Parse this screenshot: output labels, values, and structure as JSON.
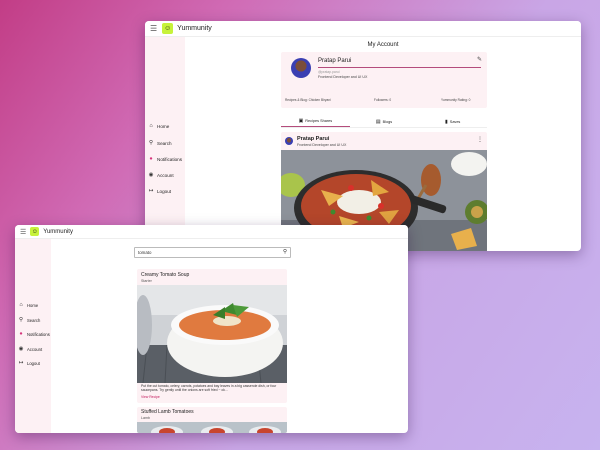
{
  "app": {
    "name": "Yummunity",
    "logo_glyph": "☺",
    "brand_color": "#c7f23a",
    "accent_color": "#b44c7c",
    "sidebar_color": "#fdf1f4"
  },
  "nav": [
    {
      "label": "Home",
      "icon": "home-icon",
      "glyph": "⌂"
    },
    {
      "label": "Search",
      "icon": "search-icon",
      "glyph": "⚲"
    },
    {
      "label": "Notifications",
      "icon": "notification-icon",
      "glyph": "●"
    },
    {
      "label": "Account",
      "icon": "account-icon",
      "glyph": "◉"
    },
    {
      "label": "Logout",
      "icon": "logout-icon",
      "glyph": "↦"
    }
  ],
  "account": {
    "title": "My Account",
    "profile": {
      "name": "Pratap Parui",
      "handle": "@pratap.parui",
      "role": "Frontend Developer and UI UX",
      "stats": [
        "Recipes & Blog: Chicken Biryani",
        "Followers: 0",
        "Yummunity Rating: 0"
      ]
    },
    "tabs": [
      {
        "label": "Recipes Shares",
        "icon": "recipe-icon",
        "glyph": "▣"
      },
      {
        "label": "Blogs",
        "icon": "blog-icon",
        "glyph": "▤"
      },
      {
        "label": "Saves",
        "icon": "bookmark-icon",
        "glyph": "▮"
      }
    ],
    "post": {
      "author": "Pratap Parui",
      "role": "Frontend Developer and UI UX"
    }
  },
  "search": {
    "query": "tomato",
    "results": [
      {
        "title": "Creamy Tomato Soup",
        "subtitle": "Starter",
        "description": "Put the cut tomato, celery, carrots, potatoes and bay leaves in a big casserole dish, or four saucepans. Try gently until the onions are soft fried ~ ok...",
        "link": "View Recipe"
      },
      {
        "title": "Stuffed Lamb Tomatoes",
        "subtitle": "Lamb"
      }
    ]
  }
}
